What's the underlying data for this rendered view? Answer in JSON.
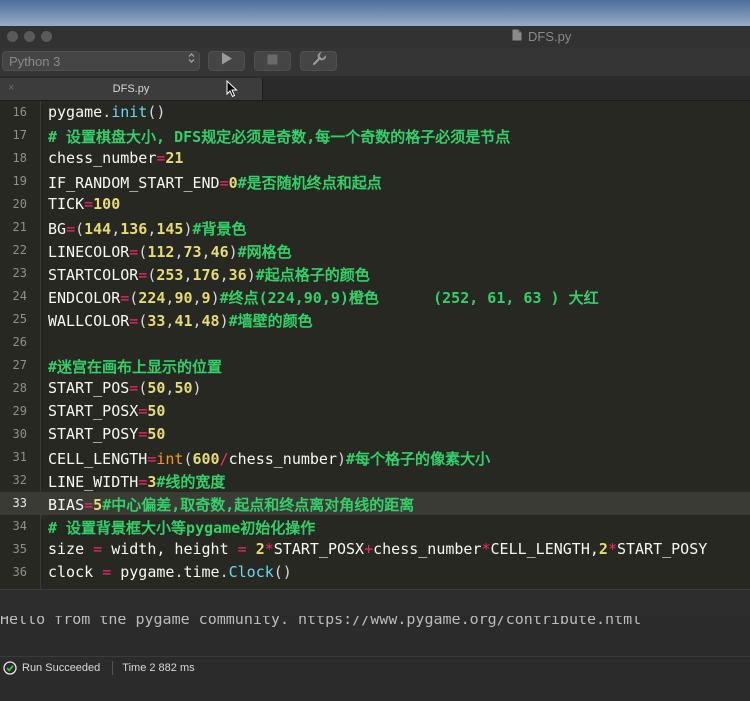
{
  "window": {
    "title": "DFS.py"
  },
  "toolbar": {
    "kernel": "Python 3"
  },
  "tab": {
    "label": "DFS.py",
    "close": "×"
  },
  "editor": {
    "current_line": "33",
    "lines": [
      {
        "num": "16",
        "tokens": [
          {
            "t": "pygame",
            "c": "v"
          },
          {
            "t": ".",
            "c": "p"
          },
          {
            "t": "init",
            "c": "k"
          },
          {
            "t": "()",
            "c": "p"
          }
        ]
      },
      {
        "num": "17",
        "tokens": [
          {
            "t": "# 设置棋盘大小, DFS规定必须是奇数,每一个奇数的格子必须是节点",
            "c": "c"
          }
        ]
      },
      {
        "num": "18",
        "tokens": [
          {
            "t": "chess_number",
            "c": "v"
          },
          {
            "t": "=",
            "c": "o"
          },
          {
            "t": "21",
            "c": "n"
          }
        ]
      },
      {
        "num": "19",
        "tokens": [
          {
            "t": "IF_RANDOM_START_END",
            "c": "v"
          },
          {
            "t": "=",
            "c": "o"
          },
          {
            "t": "0",
            "c": "n"
          },
          {
            "t": "#是否随机终点和起点",
            "c": "c"
          }
        ]
      },
      {
        "num": "20",
        "tokens": [
          {
            "t": "TICK",
            "c": "v"
          },
          {
            "t": "=",
            "c": "o"
          },
          {
            "t": "100",
            "c": "n"
          }
        ]
      },
      {
        "num": "21",
        "tokens": [
          {
            "t": "BG",
            "c": "v"
          },
          {
            "t": "=",
            "c": "o"
          },
          {
            "t": "(",
            "c": "p"
          },
          {
            "t": "144",
            "c": "n"
          },
          {
            "t": ",",
            "c": "p"
          },
          {
            "t": "136",
            "c": "n"
          },
          {
            "t": ",",
            "c": "p"
          },
          {
            "t": "145",
            "c": "n"
          },
          {
            "t": ")",
            "c": "p"
          },
          {
            "t": "#背景色",
            "c": "c"
          }
        ]
      },
      {
        "num": "22",
        "tokens": [
          {
            "t": "LINECOLOR",
            "c": "v"
          },
          {
            "t": "=",
            "c": "o"
          },
          {
            "t": "(",
            "c": "p"
          },
          {
            "t": "112",
            "c": "n"
          },
          {
            "t": ",",
            "c": "p"
          },
          {
            "t": "73",
            "c": "n"
          },
          {
            "t": ",",
            "c": "p"
          },
          {
            "t": "46",
            "c": "n"
          },
          {
            "t": ")",
            "c": "p"
          },
          {
            "t": "#网格色",
            "c": "c"
          }
        ]
      },
      {
        "num": "23",
        "tokens": [
          {
            "t": "STARTCOLOR",
            "c": "v"
          },
          {
            "t": "=",
            "c": "o"
          },
          {
            "t": "(",
            "c": "p"
          },
          {
            "t": "253",
            "c": "n"
          },
          {
            "t": ",",
            "c": "p"
          },
          {
            "t": "176",
            "c": "n"
          },
          {
            "t": ",",
            "c": "p"
          },
          {
            "t": "36",
            "c": "n"
          },
          {
            "t": ")",
            "c": "p"
          },
          {
            "t": "#起点格子的颜色",
            "c": "c"
          }
        ]
      },
      {
        "num": "24",
        "tokens": [
          {
            "t": "ENDCOLOR",
            "c": "v"
          },
          {
            "t": "=",
            "c": "o"
          },
          {
            "t": "(",
            "c": "p"
          },
          {
            "t": "224",
            "c": "n"
          },
          {
            "t": ",",
            "c": "p"
          },
          {
            "t": "90",
            "c": "n"
          },
          {
            "t": ",",
            "c": "p"
          },
          {
            "t": "9",
            "c": "n"
          },
          {
            "t": ")",
            "c": "p"
          },
          {
            "t": "#终点(224,90,9)橙色      (252, 61, 63 ) 大红",
            "c": "c"
          }
        ]
      },
      {
        "num": "25",
        "tokens": [
          {
            "t": "WALLCOLOR",
            "c": "v"
          },
          {
            "t": "=",
            "c": "o"
          },
          {
            "t": "(",
            "c": "p"
          },
          {
            "t": "33",
            "c": "n"
          },
          {
            "t": ",",
            "c": "p"
          },
          {
            "t": "41",
            "c": "n"
          },
          {
            "t": ",",
            "c": "p"
          },
          {
            "t": "48",
            "c": "n"
          },
          {
            "t": ")",
            "c": "p"
          },
          {
            "t": "#墙壁的颜色",
            "c": "c"
          }
        ]
      },
      {
        "num": "26",
        "tokens": []
      },
      {
        "num": "27",
        "tokens": [
          {
            "t": "#迷宫在画布上显示的位置",
            "c": "c"
          }
        ]
      },
      {
        "num": "28",
        "tokens": [
          {
            "t": "START_POS",
            "c": "v"
          },
          {
            "t": "=",
            "c": "o"
          },
          {
            "t": "(",
            "c": "p"
          },
          {
            "t": "50",
            "c": "n"
          },
          {
            "t": ",",
            "c": "p"
          },
          {
            "t": "50",
            "c": "n"
          },
          {
            "t": ")",
            "c": "p"
          }
        ]
      },
      {
        "num": "29",
        "tokens": [
          {
            "t": "START_POSX",
            "c": "v"
          },
          {
            "t": "=",
            "c": "o"
          },
          {
            "t": "50",
            "c": "n"
          }
        ]
      },
      {
        "num": "30",
        "tokens": [
          {
            "t": "START_POSY",
            "c": "v"
          },
          {
            "t": "=",
            "c": "o"
          },
          {
            "t": "50",
            "c": "n"
          }
        ]
      },
      {
        "num": "31",
        "tokens": [
          {
            "t": "CELL_LENGTH",
            "c": "v"
          },
          {
            "t": "=",
            "c": "o"
          },
          {
            "t": "int",
            "c": "s"
          },
          {
            "t": "(",
            "c": "p"
          },
          {
            "t": "600",
            "c": "n"
          },
          {
            "t": "/",
            "c": "o"
          },
          {
            "t": "chess_number",
            "c": "v"
          },
          {
            "t": ")",
            "c": "p"
          },
          {
            "t": "#每个格子的像素大小",
            "c": "c"
          }
        ]
      },
      {
        "num": "32",
        "tokens": [
          {
            "t": "LINE_WIDTH",
            "c": "v"
          },
          {
            "t": "=",
            "c": "o"
          },
          {
            "t": "3",
            "c": "n"
          },
          {
            "t": "#线的宽度",
            "c": "c"
          }
        ]
      },
      {
        "num": "33",
        "tokens": [
          {
            "t": "BIAS",
            "c": "v"
          },
          {
            "t": "=",
            "c": "o"
          },
          {
            "t": "5",
            "c": "n"
          },
          {
            "t": "#中心偏差,取奇数,起点和终点离对角线的距离",
            "c": "c"
          }
        ]
      },
      {
        "num": "34",
        "tokens": [
          {
            "t": "# 设置背景框大小等pygame初始化操作",
            "c": "c"
          }
        ]
      },
      {
        "num": "35",
        "tokens": [
          {
            "t": "size ",
            "c": "v"
          },
          {
            "t": "=",
            "c": "o"
          },
          {
            "t": " width, height ",
            "c": "v"
          },
          {
            "t": "=",
            "c": "o"
          },
          {
            "t": " ",
            "c": "v"
          },
          {
            "t": "2",
            "c": "n"
          },
          {
            "t": "*",
            "c": "o"
          },
          {
            "t": "START_POSX",
            "c": "v"
          },
          {
            "t": "+",
            "c": "o"
          },
          {
            "t": "chess_number",
            "c": "v"
          },
          {
            "t": "*",
            "c": "o"
          },
          {
            "t": "CELL_LENGTH,",
            "c": "v"
          },
          {
            "t": "2",
            "c": "n"
          },
          {
            "t": "*",
            "c": "o"
          },
          {
            "t": "START_POSY",
            "c": "v"
          }
        ]
      },
      {
        "num": "36",
        "tokens": [
          {
            "t": "clock ",
            "c": "v"
          },
          {
            "t": "=",
            "c": "o"
          },
          {
            "t": " pygame",
            "c": "v"
          },
          {
            "t": ".",
            "c": "p"
          },
          {
            "t": "time",
            "c": "v"
          },
          {
            "t": ".",
            "c": "p"
          },
          {
            "t": "Clock",
            "c": "k"
          },
          {
            "t": "()",
            "c": "p"
          }
        ]
      }
    ]
  },
  "output": {
    "text": "Hello from the pygame community. https://www.pygame.org/contribute.html"
  },
  "status": {
    "label": "Run Succeeded",
    "time": "Time 2 882 ms"
  },
  "colors": {
    "comment": "#33d06a",
    "number": "#e6db74",
    "operator": "#f92672",
    "function": "#66d9ef",
    "builtin": "#fd971f",
    "editor_bg": "#272822"
  },
  "icons": {
    "file": "file-icon",
    "run": "play-icon",
    "stop": "stop-icon",
    "settings": "wrench-icon",
    "success": "check-circle-icon",
    "cursor": "mouse-pointer-icon"
  }
}
